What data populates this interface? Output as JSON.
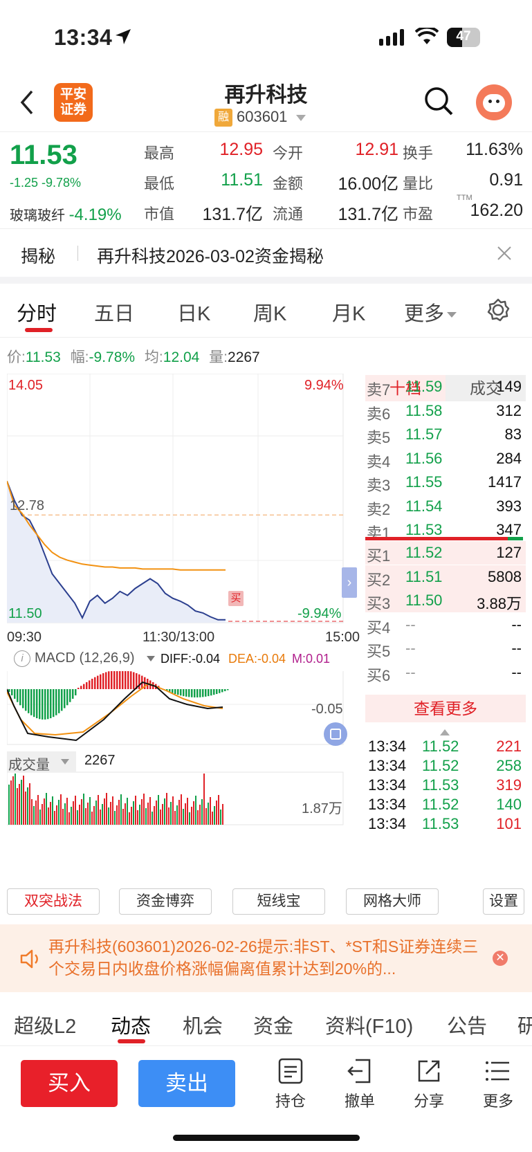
{
  "status_bar": {
    "time": "13:34",
    "battery": "47"
  },
  "header": {
    "title": "再升科技",
    "badge": "融",
    "code": "603601",
    "logo_line1": "平安",
    "logo_line2": "证券"
  },
  "quote": {
    "price": "11.53",
    "change": "-1.25 -9.78%",
    "sector_name": "玻璃玻纤",
    "sector_change": "-4.19%",
    "stats": [
      [
        {
          "label": "最高",
          "value": "12.95"
        },
        {
          "label": "今开",
          "value": "12.91"
        },
        {
          "label": "换手",
          "value": "11.63%"
        }
      ],
      [
        {
          "label": "最低",
          "value": "11.51"
        },
        {
          "label": "金额",
          "value": "16.00亿"
        },
        {
          "label": "量比",
          "value": "0.91"
        }
      ],
      [
        {
          "label": "市值",
          "value": "131.7亿"
        },
        {
          "label": "流通",
          "value": "131.7亿"
        },
        {
          "label": "市盈",
          "value": "162.20",
          "sup": "TTM"
        }
      ]
    ]
  },
  "banner": {
    "tag": "揭秘",
    "text": "再升科技2026-03-02资金揭秘"
  },
  "tabs": [
    "分时",
    "五日",
    "日K",
    "周K",
    "月K",
    "更多"
  ],
  "info_bar": {
    "price_label": "价:",
    "price": "11.53",
    "amp_label": "幅:",
    "amp": "-9.78%",
    "avg_label": "均:",
    "avg": "12.04",
    "vol_label": "量:",
    "vol": "2267"
  },
  "chart": {
    "y_top": "14.05",
    "y_mid": "12.78",
    "y_bot": "11.50",
    "pct_top": "9.94%",
    "pct_bot": "-9.94%",
    "x_start": "09:30",
    "x_mid": "11:30/13:00",
    "x_end": "15:00",
    "buy_marker": "买",
    "macd_title": "MACD (12,26,9)",
    "diff": "DIFF:-0.04",
    "dea": "DEA:-0.04",
    "m": "M:0.01",
    "macd_scale": "-0.05",
    "vol_title": "成交量",
    "vol_value": "2267",
    "vol_scale": "1.87万"
  },
  "chart_data": {
    "type": "line",
    "title": "",
    "xlabel": "",
    "ylabel": "",
    "x_ticks": [
      "09:30",
      "11:30/13:00",
      "15:00"
    ],
    "ylim": [
      11.5,
      14.05
    ],
    "series": [
      {
        "name": "",
        "values": [
          12.95,
          12.75,
          12.6,
          12.55,
          12.4,
          12.2,
          12.0,
          11.9,
          11.8,
          11.7,
          11.55,
          11.72,
          11.78,
          11.7,
          11.75,
          11.82,
          11.78,
          11.85,
          11.9,
          11.95,
          11.9,
          11.8,
          11.75,
          11.72,
          11.68,
          11.62,
          11.6,
          11.56,
          11.53,
          11.53
        ]
      },
      {
        "name": "",
        "values": [
          12.95,
          12.7,
          12.62,
          12.5,
          12.4,
          12.3,
          12.22,
          12.17,
          12.14,
          12.12,
          12.1,
          12.09,
          12.08,
          12.07,
          12.07,
          12.06,
          12.06,
          12.06,
          12.05,
          12.05,
          12.05,
          12.05,
          12.05,
          12.04,
          12.04,
          12.04,
          12.04,
          12.04,
          12.04,
          12.04
        ]
      }
    ]
  },
  "order_book": {
    "tab_active": "十档",
    "tab_other": "成交",
    "asks": [
      {
        "label": "卖7",
        "price": "11.59",
        "vol": "149"
      },
      {
        "label": "卖6",
        "price": "11.58",
        "vol": "312"
      },
      {
        "label": "卖5",
        "price": "11.57",
        "vol": "83"
      },
      {
        "label": "卖4",
        "price": "11.56",
        "vol": "284"
      },
      {
        "label": "卖3",
        "price": "11.55",
        "vol": "1417"
      },
      {
        "label": "卖2",
        "price": "11.54",
        "vol": "393"
      },
      {
        "label": "卖1",
        "price": "11.53",
        "vol": "347"
      }
    ],
    "bids": [
      {
        "label": "买1",
        "price": "11.52",
        "vol": "127"
      },
      {
        "label": "买2",
        "price": "11.51",
        "vol": "5808"
      },
      {
        "label": "买3",
        "price": "11.50",
        "vol": "3.88万"
      },
      {
        "label": "买4",
        "price": "--",
        "vol": "--"
      },
      {
        "label": "买5",
        "price": "--",
        "vol": "--"
      },
      {
        "label": "买6",
        "price": "--",
        "vol": "--"
      },
      {
        "label": "买7",
        "price": "--",
        "vol": "--"
      }
    ],
    "more": "查看更多",
    "trades": [
      {
        "time": "13:34",
        "price": "11.52",
        "vol": "221"
      },
      {
        "time": "13:34",
        "price": "11.52",
        "vol": "258"
      },
      {
        "time": "13:34",
        "price": "11.53",
        "vol": "319"
      },
      {
        "time": "13:34",
        "price": "11.52",
        "vol": "140"
      },
      {
        "time": "13:34",
        "price": "11.53",
        "vol": "101"
      }
    ]
  },
  "tools": [
    "双突战法",
    "资金博弈",
    "短线宝",
    "网格大师",
    "设置"
  ],
  "notice": {
    "text": "再升科技(603601)2026-02-26提示:非ST、*ST和S证券连续三个交易日内收盘价格涨幅偏离值累计达到20%的..."
  },
  "bottom_tabs": [
    "超级L2",
    "动态",
    "机会",
    "资金",
    "资料(F10)",
    "公告",
    "研"
  ],
  "actions": {
    "buy": "买入",
    "sell": "卖出",
    "position": "持仓",
    "cancel": "撤单",
    "share": "分享",
    "more": "更多"
  },
  "colors": {
    "up": "#e02127",
    "down": "#12a04a",
    "price_line": "#2b3f8f",
    "avg_line": "#f29111",
    "buy_btn": "#e8202a",
    "sell_btn": "#3d8ef5"
  }
}
